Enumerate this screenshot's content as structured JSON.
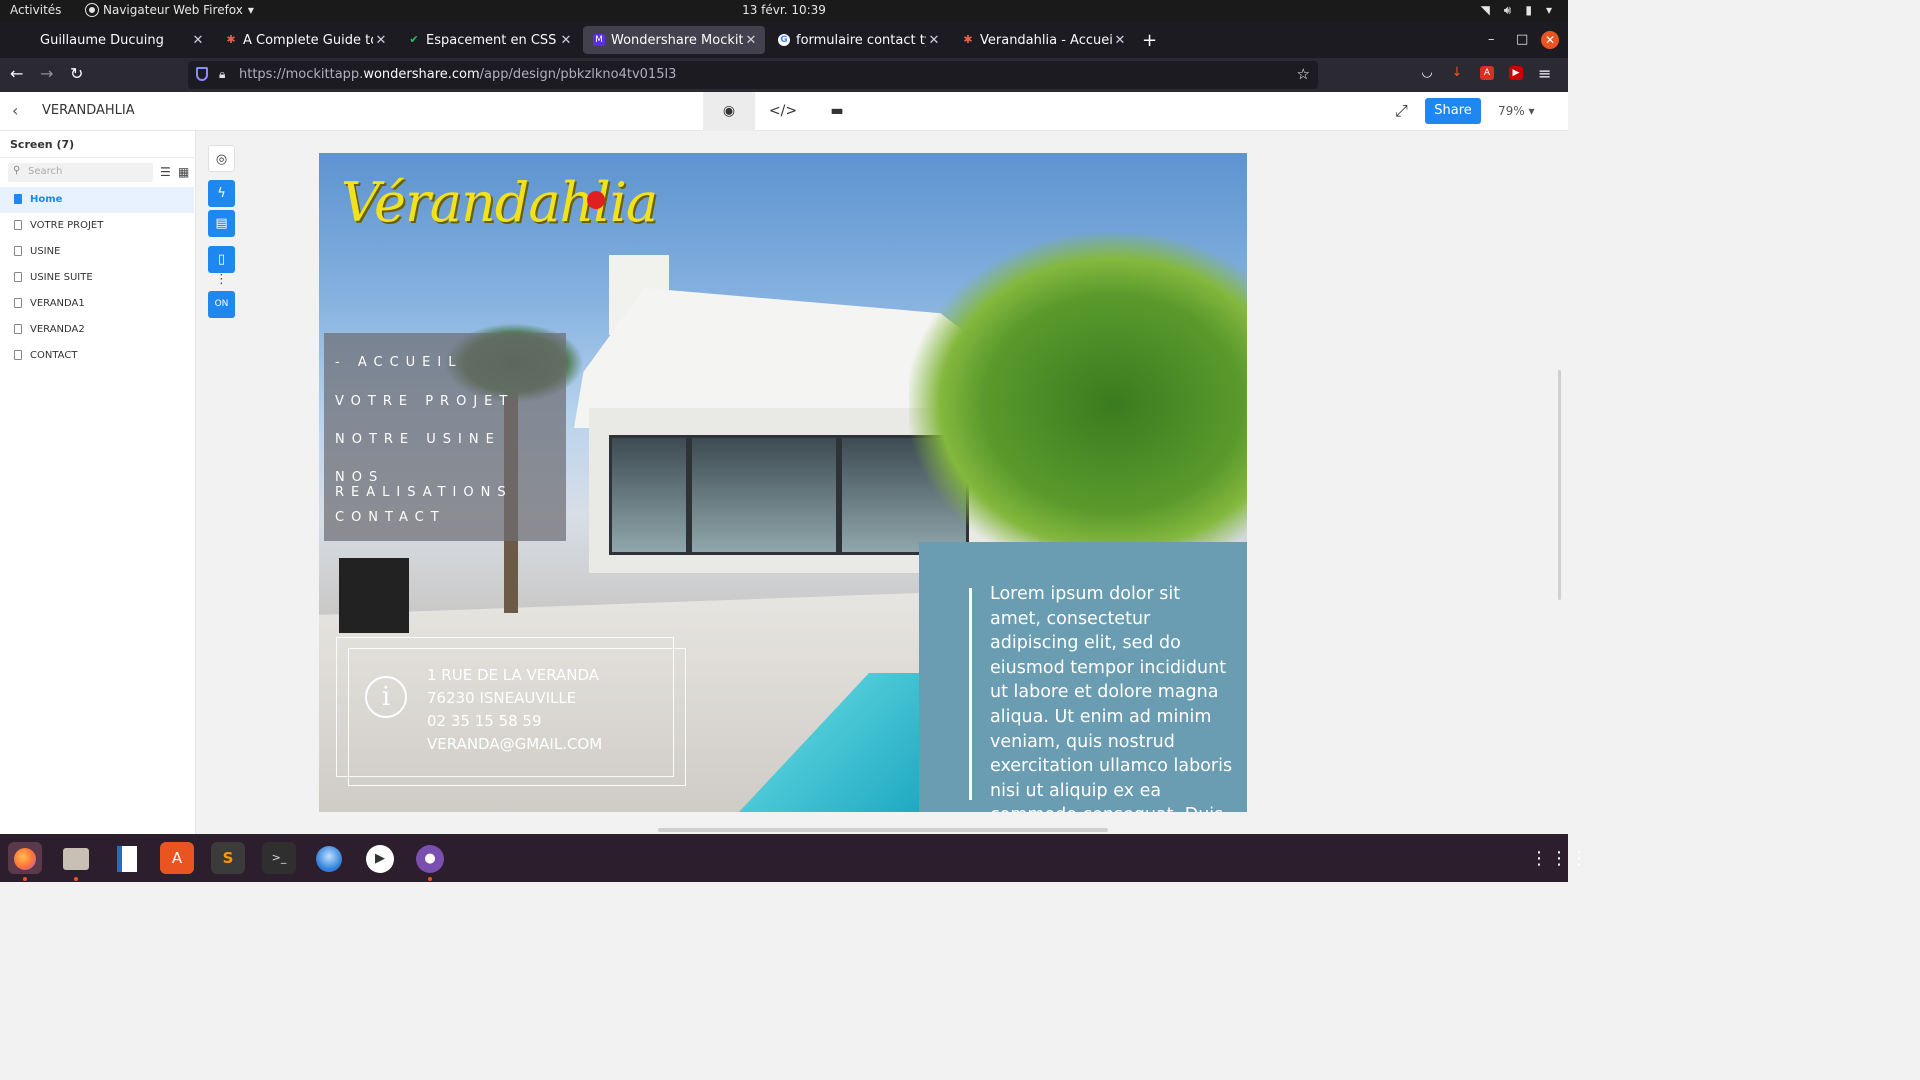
{
  "system": {
    "activities": "Activités",
    "app_name": "Navigateur Web Firefox",
    "clock": "13 févr.  10:39"
  },
  "tabs": [
    {
      "title": "Guillaume Ducuing",
      "favicon": "none",
      "color": "#1c1b22"
    },
    {
      "title": "A Complete Guide to Flex",
      "favicon": "asterisk-icon",
      "color": "#e8604c"
    },
    {
      "title": "Espacement en CSS (pad",
      "favicon": "check-icon",
      "color": "#22c55e"
    },
    {
      "title": "Wondershare Mockitt - V",
      "favicon": "mockitt-icon",
      "color": "#5b2ee0"
    },
    {
      "title": "formulaire contact type",
      "favicon": "google-icon",
      "color": "#ffffff"
    },
    {
      "title": "Verandahlia - Accueil",
      "favicon": "asterisk-icon",
      "color": "#e8604c"
    }
  ],
  "url": {
    "prefix": "https://mockittapp.",
    "domain": "wondershare.com",
    "path": "/app/design/pbkzlkno4tv015l3"
  },
  "app": {
    "project_name": "VERANDAHLIA",
    "share_label": "Share",
    "zoom": "79%",
    "modes": [
      "eye-icon",
      "code-icon",
      "comment-icon"
    ]
  },
  "screens_panel": {
    "header": "Screen  (7)",
    "search_placeholder": "Search",
    "items": [
      {
        "label": "Home",
        "selected": true
      },
      {
        "label": "VOTRE PROJET",
        "selected": false
      },
      {
        "label": "USINE",
        "selected": false
      },
      {
        "label": "USINE SUITE",
        "selected": false
      },
      {
        "label": "VERANDA1",
        "selected": false
      },
      {
        "label": "VERANDA2",
        "selected": false
      },
      {
        "label": "CONTACT",
        "selected": false
      }
    ]
  },
  "design": {
    "logo": "Vérandahlia",
    "menu": [
      "- ACCUEIL",
      "VOTRE PROJET",
      "NOTRE USINE",
      "NOS REALISATIONS",
      "CONTACT"
    ],
    "contact_lines": [
      " 1 RUE DE LA VERANDA",
      "76230 ISNEAUVILLE",
      "02 35 15 58 59",
      "VERANDA@GMAIL.COM"
    ],
    "lorem": "Lorem ipsum dolor sit amet, consectetur adipiscing elit, sed do eiusmod tempor incididunt ut labore et dolore magna aliqua. Ut enim ad minim veniam, quis nostrud exercitation ullamco laboris nisi ut aliquip ex ea commodo consequat. Duis aute irure"
  },
  "colors": {
    "accent": "#1e87f0",
    "lorem_panel": "#6a9db1",
    "logo_yellow": "#f1e21d"
  },
  "dock": [
    "firefox-icon",
    "files-icon",
    "writer-icon",
    "software-icon",
    "sublime-icon",
    "terminal-icon",
    "thunderbird-icon",
    "media-player-icon",
    "github-icon"
  ]
}
